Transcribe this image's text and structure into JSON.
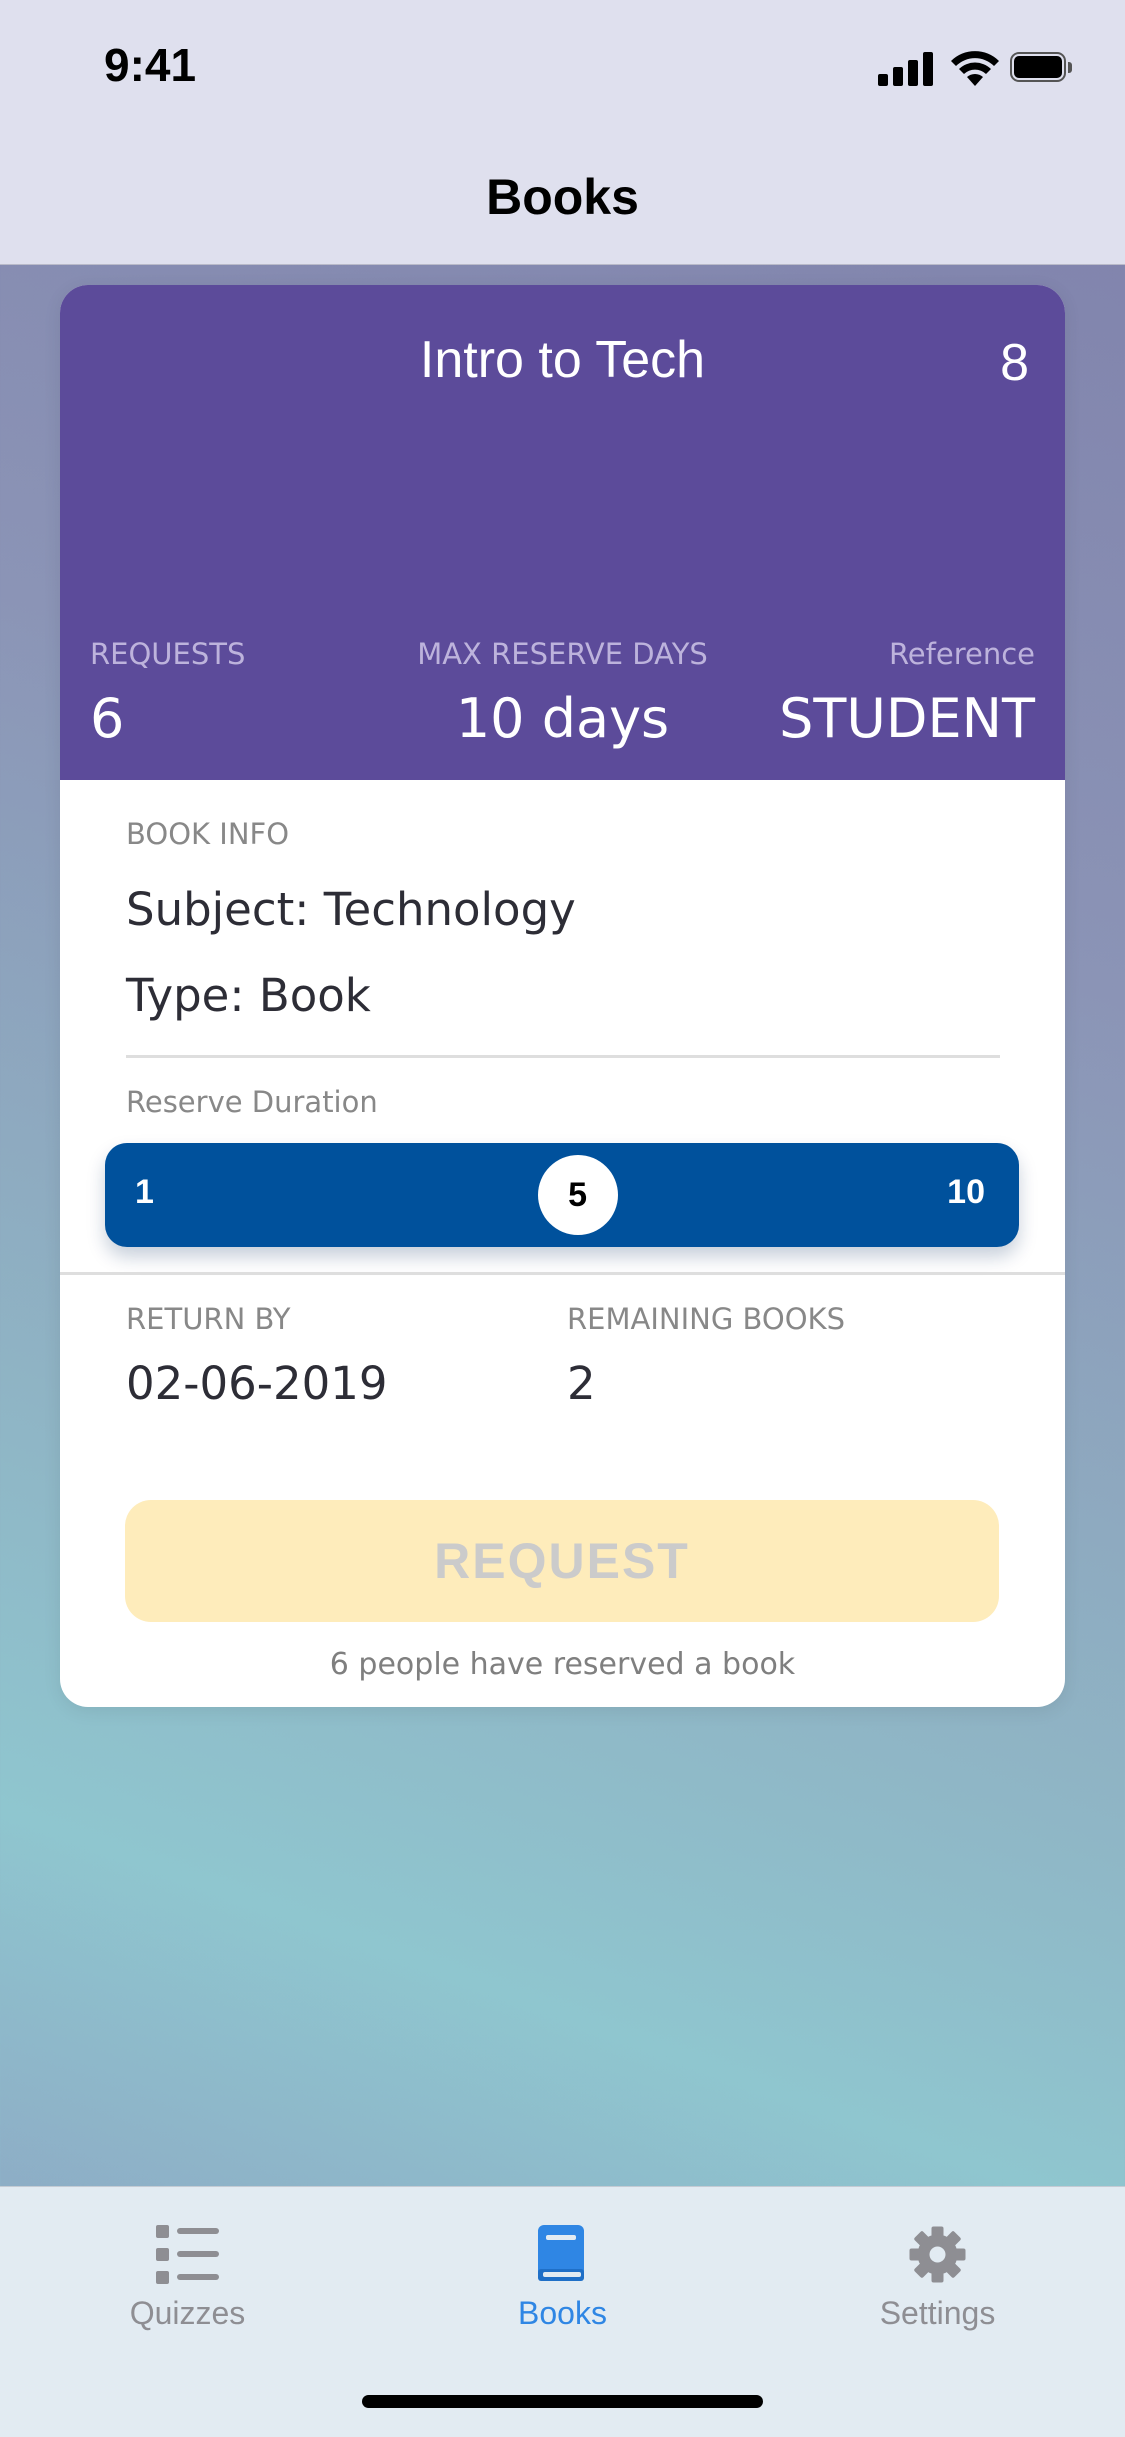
{
  "status_bar": {
    "time": "9:41"
  },
  "nav": {
    "title": "Books"
  },
  "card": {
    "title": "Intro to Tech",
    "count": "8",
    "stats": {
      "requests_label": "REQUESTS",
      "requests_value": "6",
      "max_days_label": "MAX RESERVE DAYS",
      "max_days_value": "10 days",
      "reference_label": "Reference",
      "reference_value": "STUDENT"
    },
    "book_info": {
      "label": "BOOK INFO",
      "subject": "Subject: Technology",
      "type": "Type: Book"
    },
    "reserve": {
      "label": "Reserve Duration",
      "min": "1",
      "max": "10",
      "value": "5",
      "value_fraction": 0.444
    },
    "return_by": {
      "label": "RETURN BY",
      "value": "02-06-2019"
    },
    "remaining": {
      "label": "REMAINING BOOKS",
      "value": "2"
    },
    "request_button": "REQUEST",
    "note": "6 people have reserved a book"
  },
  "tabs": [
    {
      "label": "Quizzes",
      "icon": "checklist-icon",
      "active": false
    },
    {
      "label": "Books",
      "icon": "book-icon",
      "active": true
    },
    {
      "label": "Settings",
      "icon": "gear-icon",
      "active": false
    }
  ],
  "colors": {
    "header_purple": "#5c4b9a",
    "slider_blue": "#00519c",
    "button_disabled": "#feecbb",
    "tab_active": "#2f86e4",
    "tab_inactive": "#8e8e93"
  }
}
